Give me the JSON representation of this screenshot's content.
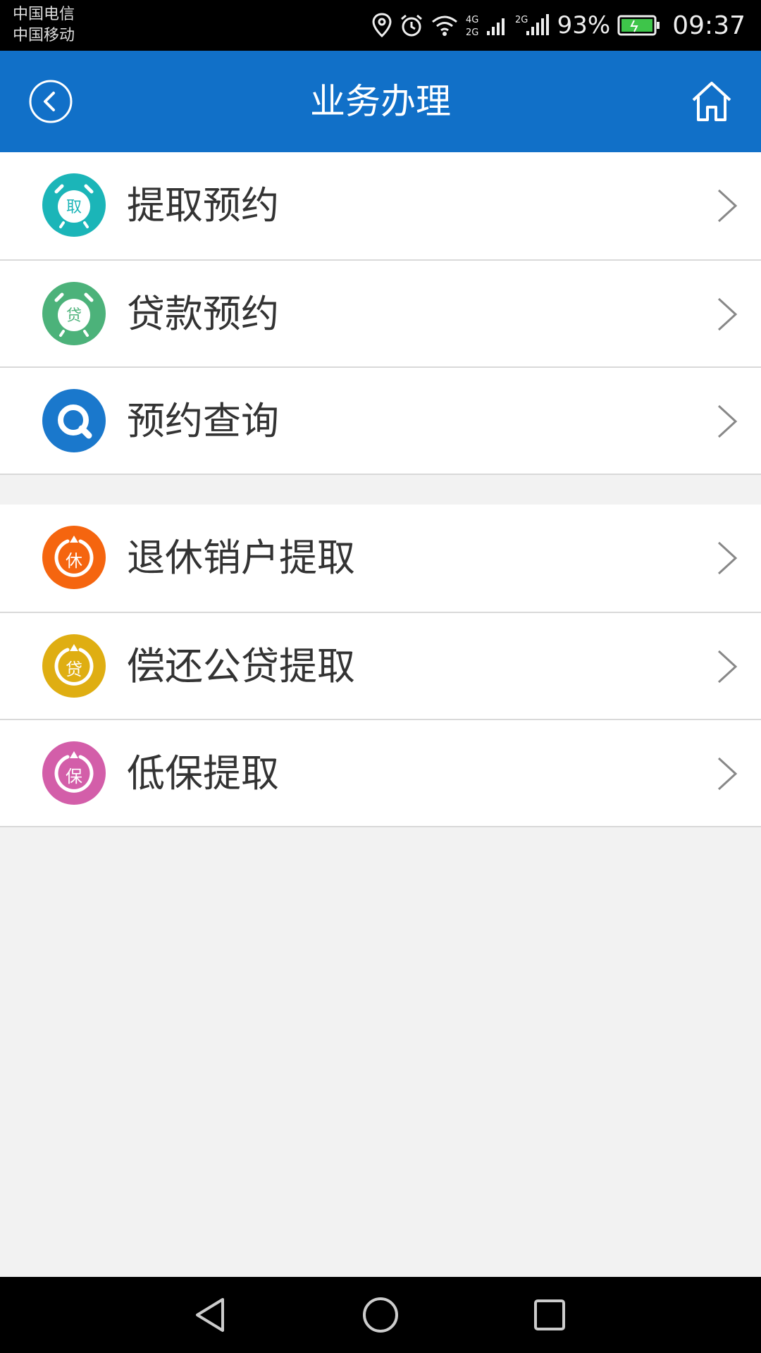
{
  "status_bar": {
    "carrier1": "中国电信",
    "carrier2": "中国移动",
    "network1": "4G",
    "network2": "2G",
    "network3": "2G",
    "battery": "93%",
    "time": "09:37",
    "icons": [
      "location-icon",
      "alarm-icon",
      "wifi-icon",
      "signal-icon",
      "battery-icon"
    ]
  },
  "header": {
    "title": "业务办理",
    "back_icon": "back-circle-icon",
    "home_icon": "home-icon",
    "background": "#1170c8"
  },
  "groups": [
    {
      "items": [
        {
          "label": "提取预约",
          "icon_char": "取",
          "color": "#1bb5b8"
        },
        {
          "label": "贷款预约",
          "icon_char": "贷",
          "color": "#4cb27a"
        },
        {
          "label": "预约查询",
          "icon_char": "",
          "color": "#1a78cc"
        }
      ]
    },
    {
      "items": [
        {
          "label": "退休销户提取",
          "icon_char": "休",
          "color": "#f5650f"
        },
        {
          "label": "偿还公贷提取",
          "icon_char": "贷",
          "color": "#dfae12"
        },
        {
          "label": "低保提取",
          "icon_char": "保",
          "color": "#d35ea9"
        }
      ]
    }
  ],
  "nav_bar": {
    "icons": [
      "nav-back-icon",
      "nav-home-icon",
      "nav-recent-icon"
    ]
  }
}
